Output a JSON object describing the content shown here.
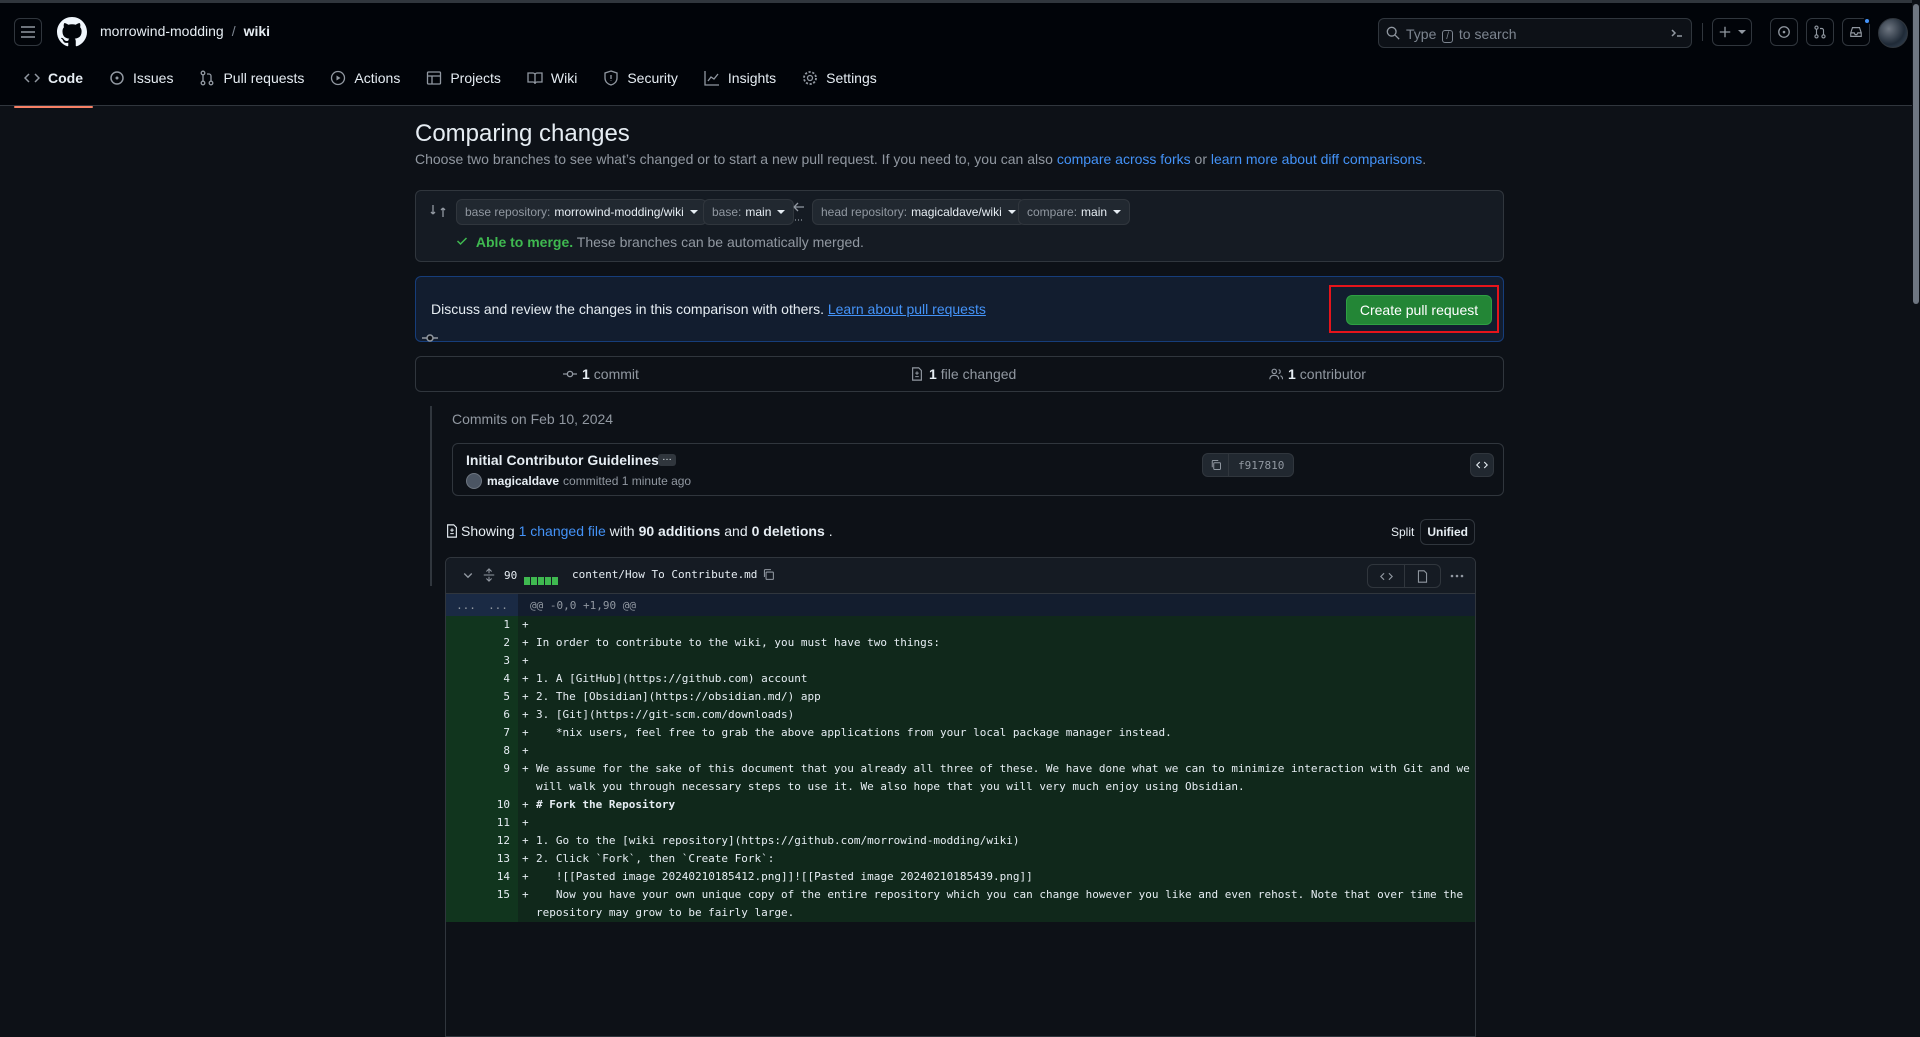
{
  "header": {
    "owner": "morrowind-modding",
    "sep": "/",
    "repo": "wiki",
    "search_prefix": "Type",
    "search_key": "/",
    "search_suffix": "to search"
  },
  "tabs": [
    {
      "label": "Code",
      "icon": "code-icon"
    },
    {
      "label": "Issues",
      "icon": "issue-icon"
    },
    {
      "label": "Pull requests",
      "icon": "pull-request-icon"
    },
    {
      "label": "Actions",
      "icon": "play-icon"
    },
    {
      "label": "Projects",
      "icon": "table-icon"
    },
    {
      "label": "Wiki",
      "icon": "book-icon"
    },
    {
      "label": "Security",
      "icon": "shield-icon"
    },
    {
      "label": "Insights",
      "icon": "graph-icon"
    },
    {
      "label": "Settings",
      "icon": "gear-icon"
    }
  ],
  "compare": {
    "title": "Comparing changes",
    "subtitle_pre": "Choose two branches to see what’s changed or to start a new pull request. If you need to, you can also ",
    "link_forks": "compare across forks",
    "subtitle_mid": " or ",
    "link_learn": "learn more about diff comparisons",
    "subtitle_end": ".",
    "base_repo_label": "base repository:",
    "base_repo_value": "morrowind-modding/wiki",
    "base_label": "base:",
    "base_value": "main",
    "head_repo_label": "head repository:",
    "head_repo_value": "magicaldave/wiki",
    "compare_label": "compare:",
    "compare_value": "main",
    "merge_status": "Able to merge.",
    "merge_text": "These branches can be automatically merged."
  },
  "discuss": {
    "text": "Discuss and review the changes in this comparison with others.",
    "link": "Learn about pull requests",
    "button": "Create pull request"
  },
  "summary": {
    "commits_count": "1",
    "commits_label": "commit",
    "files_count": "1",
    "files_label": "file changed",
    "contributors_count": "1",
    "contributors_label": "contributor"
  },
  "commits": {
    "date_header": "Commits on Feb 10, 2024",
    "title": "Initial Contributor Guidelines",
    "ellipsis": "…",
    "author": "magicaldave",
    "meta": "committed 1 minute ago",
    "sha": "f917810"
  },
  "showing": {
    "pre": "Showing",
    "link": "1 changed file",
    "with": "with",
    "additions": "90 additions",
    "and": "and",
    "deletions": "0 deletions",
    "end": ".",
    "split": "Split",
    "unified": "Unified"
  },
  "diff": {
    "count": "90",
    "filename": "content/How To Contribute.md",
    "hunk_gut_a": "...",
    "hunk_gut_b": "...",
    "hunk": "@@ -0,0 +1,90 @@",
    "lines": [
      {
        "n": "1",
        "text": ""
      },
      {
        "n": "2",
        "text": "In order to contribute to the wiki, you must have two things:"
      },
      {
        "n": "3",
        "text": ""
      },
      {
        "n": "4",
        "text": "1. A [GitHub](https://github.com) account"
      },
      {
        "n": "5",
        "text": "2. The [Obsidian](https://obsidian.md/) app"
      },
      {
        "n": "6",
        "text": "3. [Git](https://git-scm.com/downloads)"
      },
      {
        "n": "7",
        "text": "   *nix users, feel free to grab the above applications from your local package manager instead."
      },
      {
        "n": "8",
        "text": ""
      },
      {
        "n": "9",
        "text": "We assume for the sake of this document that you already all three of these. We have done what we can to minimize interaction with Git and we will walk you through necessary steps to use it. We also hope that you will very much enjoy using Obsidian."
      },
      {
        "n": "10",
        "text": "# Fork the Repository"
      },
      {
        "n": "11",
        "text": ""
      },
      {
        "n": "12",
        "text": "1. Go to the [wiki repository](https://github.com/morrowind-modding/wiki)"
      },
      {
        "n": "13",
        "text": "2. Click `Fork`, then `Create Fork`:"
      },
      {
        "n": "14",
        "text": "   ![[Pasted image 20240210185412.png]]![[Pasted image 20240210185439.png]]"
      },
      {
        "n": "15",
        "text": "   Now you have your own unique copy of the entire repository which you can change however you like and even rehost. Note that over time the repository may grow to be fairly large."
      }
    ]
  },
  "colors": {
    "accent": "#4493f8",
    "success": "#3fb950",
    "button_green": "#238636",
    "highlight_red": "#e5141b",
    "tab_underline": "#f78166"
  }
}
